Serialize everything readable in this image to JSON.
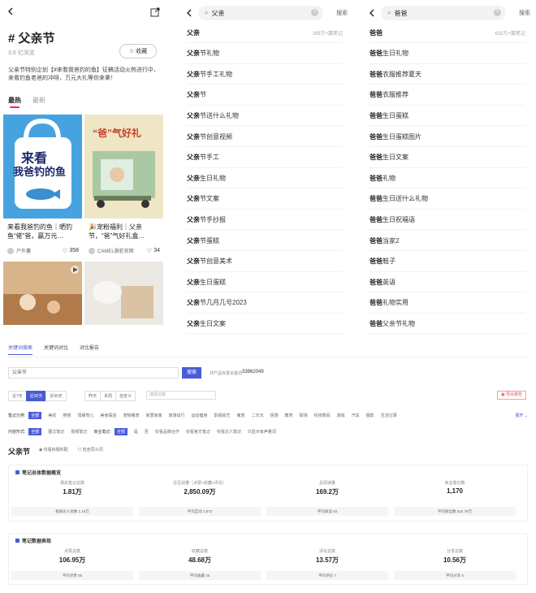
{
  "topic": {
    "title": "# 父亲节",
    "views": "3.6 亿浏览",
    "fav_label": "收藏",
    "desc": "父亲节特别企划【#来看我爸钓的鱼】征稿活动火热进行中，来看钓鱼老爸的冲呀，万元大礼等你来拿！",
    "tab_hot": "最热",
    "tab_new": "最新"
  },
  "cards": [
    {
      "title": "来看我爸钓的鱼｜晒钓鱼“佬”爸，赢万元…",
      "author": "户外薯",
      "likes": "358",
      "img_text_1": "来看",
      "img_text_2": "我爸钓的鱼"
    },
    {
      "title": "🎉宠粉福利｜父亲节，“爸”气好礼盒…",
      "author": "CAMEL骆驼官网",
      "likes": "34",
      "img_text_1": "“爸”气好礼"
    },
    {
      "title": "",
      "author": "",
      "likes": ""
    },
    {
      "title": "",
      "author": "",
      "likes": ""
    }
  ],
  "search1": {
    "query": "父亲",
    "button": "搜索",
    "suggestions": [
      {
        "kw": "父亲",
        "rest": "",
        "count": "169万+篇笔记"
      },
      {
        "kw": "父亲",
        "rest": "节礼物",
        "count": ""
      },
      {
        "kw": "父亲",
        "rest": "节手工礼物",
        "count": ""
      },
      {
        "kw": "父亲",
        "rest": "节",
        "count": ""
      },
      {
        "kw": "父亲",
        "rest": "节送什么礼物",
        "count": ""
      },
      {
        "kw": "父亲",
        "rest": "节创意视频",
        "count": ""
      },
      {
        "kw": "父亲",
        "rest": "节手工",
        "count": ""
      },
      {
        "kw": "父亲",
        "rest": "生日礼物",
        "count": ""
      },
      {
        "kw": "父亲",
        "rest": "节文案",
        "count": ""
      },
      {
        "kw": "父亲",
        "rest": "节手抄报",
        "count": ""
      },
      {
        "kw": "父亲",
        "rest": "节蛋糕",
        "count": ""
      },
      {
        "kw": "父亲",
        "rest": "节创意美术",
        "count": ""
      },
      {
        "kw": "父亲",
        "rest": "生日蛋糕",
        "count": ""
      },
      {
        "kw": "父亲",
        "rest": "节几月几号2023",
        "count": ""
      },
      {
        "kw": "父亲",
        "rest": "生日文案",
        "count": ""
      }
    ]
  },
  "search2": {
    "query": "爸爸",
    "button": "搜索",
    "suggestions": [
      {
        "kw": "爸爸",
        "rest": "",
        "count": "633万+篇笔记"
      },
      {
        "kw": "爸爸",
        "rest": "生日礼物",
        "count": ""
      },
      {
        "kw": "爸爸",
        "rest": "衣服推荐夏天",
        "count": ""
      },
      {
        "kw": "爸爸",
        "rest": "衣服推荐",
        "count": ""
      },
      {
        "kw": "爸爸",
        "rest": "生日蛋糕",
        "count": ""
      },
      {
        "kw": "爸爸",
        "rest": "生日蛋糕图片",
        "count": ""
      },
      {
        "kw": "爸爸",
        "rest": "生日文案",
        "count": ""
      },
      {
        "kw": "爸爸",
        "rest": "礼物",
        "count": ""
      },
      {
        "kw": "爸爸",
        "rest": "生日送什么礼物",
        "count": ""
      },
      {
        "kw": "爸爸",
        "rest": "生日祝福语",
        "count": ""
      },
      {
        "kw": "爸爸",
        "rest": "当家2",
        "count": ""
      },
      {
        "kw": "爸爸",
        "rest": "鞋子",
        "count": ""
      },
      {
        "kw": "爸爸",
        "rest": "英语",
        "count": ""
      },
      {
        "kw": "爸爸",
        "rest": "礼物实用",
        "count": ""
      },
      {
        "kw": "爸爸",
        "rest": "父亲节礼物",
        "count": ""
      }
    ]
  },
  "panel": {
    "tabs": [
      "关键词搜索",
      "关键词对比",
      "对比报告"
    ],
    "keyword": "父亲节",
    "search_btn": "搜索",
    "hint": "共产品收录关键词",
    "total": "33962049",
    "range_seg": [
      "近7天",
      "近30天",
      "近90天"
    ],
    "period_seg": [
      "昨天",
      "本周",
      "自定义"
    ],
    "date_placeholder": "选择日期",
    "export": "导出报告",
    "row1": {
      "label": "笔记分类:",
      "chips": [
        "全部",
        "美妆",
        "穿搭",
        "母婴育儿",
        "美食探店",
        "宠物萌宠",
        "家居家装",
        "旅游出行",
        "运动健身",
        "影视综艺",
        "萌宠",
        "二次元",
        "情感",
        "教育",
        "职场",
        "科技数码",
        "游戏",
        "汽车",
        "摄影",
        "生活记录"
      ],
      "more": "展开 ⌄"
    },
    "row2": {
      "label": "内容形式:",
      "chips": [
        "全部",
        "图文笔记",
        "视频笔记"
      ],
      "label2": "商业笔记:",
      "chips2": [
        "全部",
        "是",
        "否"
      ],
      "opts": [
        "仅看品牌合作",
        "仅看官方笔记",
        "仅看达人笔记",
        "只显示有声量词"
      ]
    },
    "section_title": "父亲节",
    "section_opts": [
      "◉ 仅看标题匹配",
      "☐ 包含同义词"
    ],
    "box1": {
      "title": "笔记总体数据概览",
      "metrics": [
        {
          "label": "相关笔记总数",
          "value": "1.81万"
        },
        {
          "label": "总互动量（点赞+收藏+评论）",
          "value": "2,850.09万"
        },
        {
          "label": "总阅读量",
          "value": "169.2万"
        },
        {
          "label": "商业笔记数",
          "value": "1,170"
        }
      ],
      "subs": [
        "相关达人总数 1.15万",
        "平均互动 1,572",
        "平均阅读 93",
        "平均粉丝数 520.79万"
      ]
    },
    "box2": {
      "title": "笔记数据表现",
      "metrics": [
        {
          "label": "点赞总数",
          "value": "106.95万"
        },
        {
          "label": "收藏总数",
          "value": "48.68万"
        },
        {
          "label": "评论总数",
          "value": "13.57万"
        },
        {
          "label": "分享总数",
          "value": "10.56万"
        }
      ],
      "subs": [
        "平均点赞 59",
        "平均收藏 26",
        "平均评论 7",
        "平均分享 6"
      ]
    }
  },
  "colors": {
    "accent": "#4b5bd8",
    "brand_red": "#ff2442"
  }
}
